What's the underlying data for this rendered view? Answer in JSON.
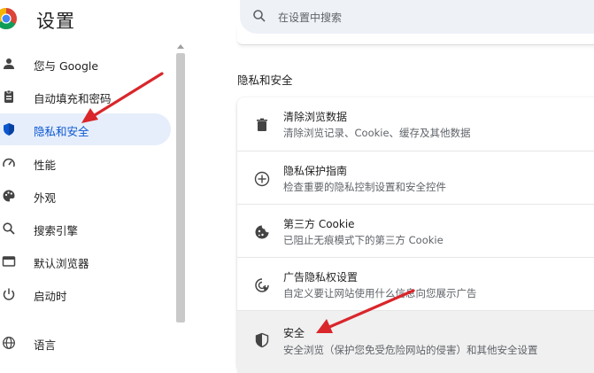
{
  "app": {
    "title": "设置"
  },
  "search": {
    "placeholder": "在设置中搜索"
  },
  "sidebar": {
    "items": [
      {
        "label": "您与 Google",
        "icon": "person-icon",
        "active": false
      },
      {
        "label": "自动填充和密码",
        "icon": "clipboard-icon",
        "active": false
      },
      {
        "label": "隐私和安全",
        "icon": "shield-icon",
        "active": true
      },
      {
        "label": "性能",
        "icon": "speedometer-icon",
        "active": false
      },
      {
        "label": "外观",
        "icon": "palette-icon",
        "active": false
      },
      {
        "label": "搜索引擎",
        "icon": "search-icon",
        "active": false
      },
      {
        "label": "默认浏览器",
        "icon": "browser-window-icon",
        "active": false
      },
      {
        "label": "启动时",
        "icon": "power-icon",
        "active": false
      },
      {
        "label": "语言",
        "icon": "globe-icon",
        "active": false
      }
    ]
  },
  "main": {
    "section_title": "隐私和安全",
    "rows": [
      {
        "title": "清除浏览数据",
        "subtitle": "清除浏览记录、Cookie、缓存及其他数据",
        "icon": "trash-icon"
      },
      {
        "title": "隐私保护指南",
        "subtitle": "检查重要的隐私控制设置和安全控件",
        "icon": "compass-plus-icon"
      },
      {
        "title": "第三方 Cookie",
        "subtitle": "已阻止无痕模式下的第三方 Cookie",
        "icon": "cookie-icon"
      },
      {
        "title": "广告隐私权设置",
        "subtitle": "自定义要让网站使用什么信息向您展示广告",
        "icon": "ad-privacy-icon"
      },
      {
        "title": "安全",
        "subtitle": "安全浏览（保护您免受危险网站的侵害）和其他安全设置",
        "icon": "security-shield-icon"
      }
    ]
  },
  "colors": {
    "accent": "#0b57d0",
    "active_bg": "#e6eefc",
    "annotation_arrow": "#d9262b"
  }
}
